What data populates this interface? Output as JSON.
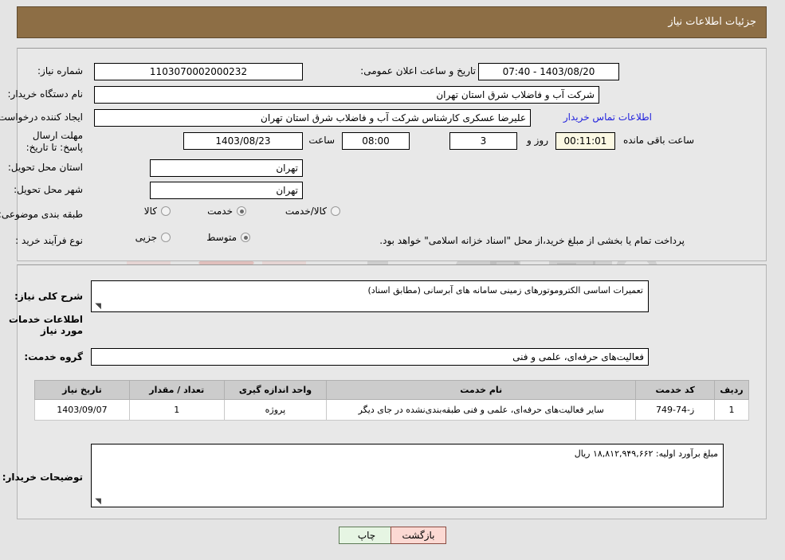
{
  "header": {
    "title": "جزئیات اطلاعات نیاز"
  },
  "top_form": {
    "need_number_label": "شماره نیاز:",
    "need_number_value": "1103070002000232",
    "announce_label": "تاریخ و ساعت اعلان عمومی:",
    "announce_value": "1403/08/20 - 07:40",
    "buyer_org_label": "نام دستگاه خریدار:",
    "buyer_org_value": "شرکت آب و فاضلاب شرق استان تهران",
    "creator_label": "ایجاد کننده درخواست:",
    "creator_value": "علیرضا عسکری کارشناس شرکت آب و فاضلاب شرق استان تهران",
    "contact_link": "اطلاعات تماس خریدار",
    "deadline_label": "مهلت ارسال پاسخ: تا تاریخ:",
    "deadline_date": "1403/08/23",
    "hour_label": "ساعت",
    "deadline_time": "08:00",
    "days_remaining": "3",
    "days_word": "روز و",
    "time_remaining": "00:11:01",
    "remaining_suffix": "ساعت باقی مانده",
    "province_label": "استان محل تحویل:",
    "province_value": "تهران",
    "city_label": "شهر محل تحویل:",
    "city_value": "تهران",
    "category_label": "طبقه بندی موضوعی:",
    "category_options": [
      {
        "label": "کالا",
        "selected": false
      },
      {
        "label": "خدمت",
        "selected": true
      },
      {
        "label": "کالا/خدمت",
        "selected": false
      }
    ],
    "process_label": "نوع فرآیند خرید :",
    "process_options": [
      {
        "label": "جزیی",
        "selected": false
      },
      {
        "label": "متوسط",
        "selected": true
      }
    ],
    "process_note": "پرداخت تمام یا بخشی از مبلغ خرید،از محل \"اسناد خزانه اسلامی\" خواهد بود."
  },
  "description": {
    "label": "شرح کلی نیاز:",
    "value": "تعمیرات اساسی الکتروموتورهای زمینی سامانه های آبرسانی (مطابق اسناد)"
  },
  "services_section": {
    "heading": "اطلاعات خدمات مورد نیاز",
    "group_label": "گروه خدمت:",
    "group_value": "فعالیت‌های حرفه‌ای، علمی و فنی"
  },
  "table": {
    "columns": [
      "ردیف",
      "کد خدمت",
      "نام خدمت",
      "واحد اندازه گیری",
      "تعداد / مقدار",
      "تاریخ نیاز"
    ],
    "rows": [
      {
        "radif": "1",
        "code": "ز-74-749",
        "name": "سایر فعالیت‌های حرفه‌ای، علمی و فنی طبقه‌بندی‌نشده در جای دیگر",
        "unit": "پروژه",
        "quantity": "1",
        "date": "1403/09/07"
      }
    ]
  },
  "buyer_notes": {
    "label": "توضیحات خریدار:",
    "value": "مبلغ برآورد اولیه: ۱۸,۸۱۲,۹۴۹,۶۶۲ ریال"
  },
  "footer": {
    "print_label": "چاپ",
    "back_label": "بازگشت"
  },
  "watermark": {
    "text": "AriaTender.net"
  },
  "colors": {
    "header_bg": "#8d6e45",
    "panel_bg": "#e8e8e8",
    "page_bg": "#e4e4e4",
    "link": "#2222dd",
    "table_header_bg": "#cccccc",
    "print_btn_bg": "#e6f5e3",
    "back_btn_bg": "#fcd9d3",
    "countdown_bg": "#fbf8e3"
  }
}
